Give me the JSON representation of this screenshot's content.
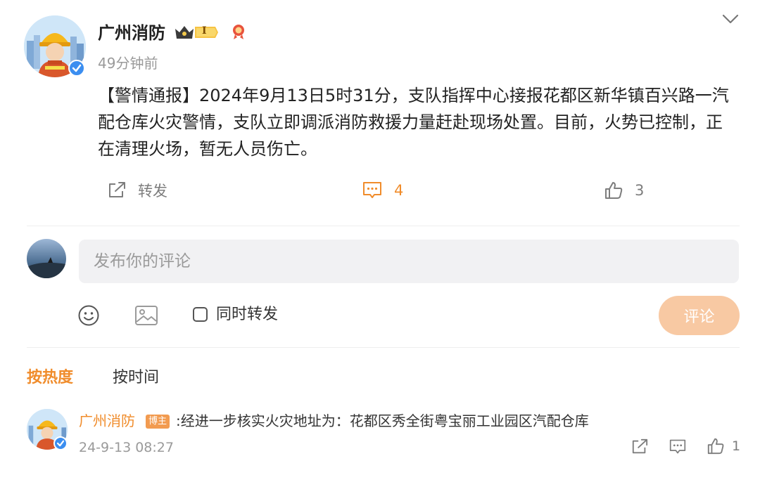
{
  "post": {
    "author": "广州消防",
    "level_badge": "I",
    "time": "49分钟前",
    "text": "【警情通报】2024年9月13日5时31分，支队指挥中心接报花都区新华镇百兴路一汽配仓库火灾警情，支队立即调派消防救援力量赶赴现场处置。目前，火势已控制，正在清理火场，暂无人员伤亡。"
  },
  "actions": {
    "forward_label": "转发",
    "comment_count": "4",
    "like_count": "3"
  },
  "composer": {
    "placeholder": "发布你的评论",
    "also_forward_label": "同时转发",
    "submit_label": "评论"
  },
  "sort_tabs": {
    "hot": "按热度",
    "time": "按时间"
  },
  "comments": [
    {
      "author": "广州消防",
      "badge": "博主",
      "text": ":经进一步核实火灾地址为：花都区秀全街粤宝丽工业园区汽配仓库",
      "time": "24-9-13 08:27",
      "like_count": "1"
    }
  ],
  "colors": {
    "accent": "#f08c2b",
    "submit_disabled": "#f8c9a3",
    "verified": "#3b8ef0",
    "input_bg": "#f1f1f3"
  }
}
